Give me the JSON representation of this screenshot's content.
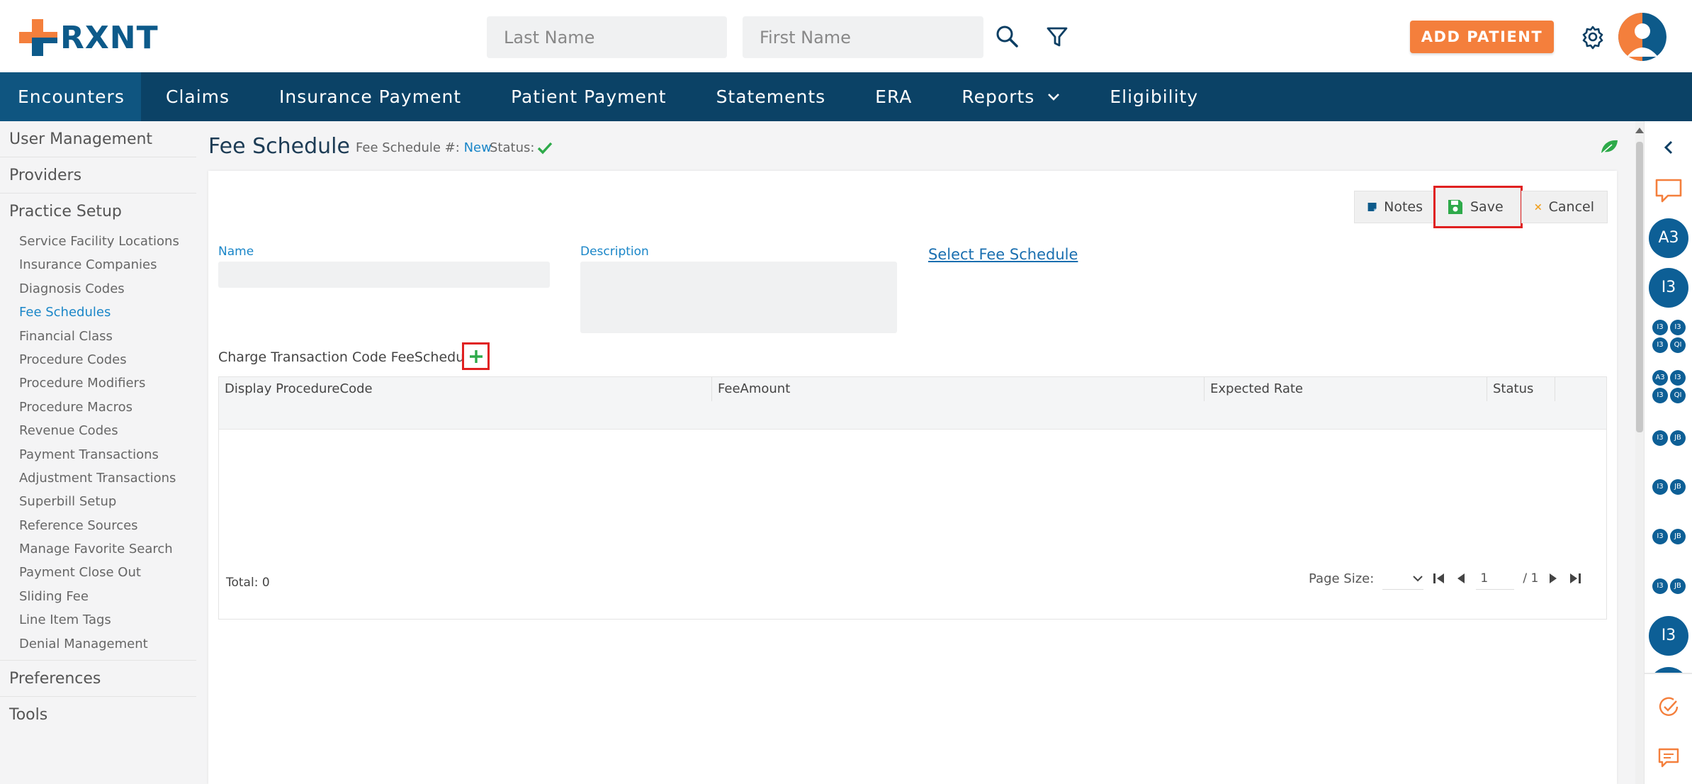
{
  "header": {
    "logo_text": "RXNT",
    "last_name_placeholder": "Last Name",
    "first_name_placeholder": "First Name",
    "add_patient_label": "ADD PATIENT",
    "icons": [
      "search-icon",
      "filter-icon",
      "gear-icon",
      "user-avatar-icon"
    ]
  },
  "nav": {
    "items": [
      "Encounters",
      "Claims",
      "Insurance Payment",
      "Patient Payment",
      "Statements",
      "ERA",
      "Reports",
      "Eligibility"
    ],
    "active": "Encounters"
  },
  "sidebar": {
    "sections": [
      "User Management",
      "Providers",
      "Practice Setup",
      "Preferences",
      "Tools"
    ],
    "practice_setup_items": [
      "Service Facility Locations",
      "Insurance Companies",
      "Diagnosis Codes",
      "Fee Schedules",
      "Financial Class",
      "Procedure Codes",
      "Procedure Modifiers",
      "Procedure Macros",
      "Revenue Codes",
      "Payment Transactions",
      "Adjustment Transactions",
      "Superbill Setup",
      "Reference Sources",
      "Manage Favorite Search",
      "Payment Close Out",
      "Sliding Fee",
      "Line Item Tags",
      "Denial Management"
    ],
    "active_item": "Fee Schedules"
  },
  "page": {
    "title": "Fee Schedule",
    "fee_schedule_label": "Fee Schedule #:",
    "fee_schedule_value": "New",
    "status_label": "Status:"
  },
  "toolbar": {
    "notes_label": "Notes",
    "save_label": "Save",
    "cancel_label": "Cancel"
  },
  "form": {
    "name_label": "Name",
    "name_value": "",
    "description_label": "Description",
    "description_value": "",
    "select_fee_schedule_link": "Select Fee Schedule",
    "charge_transaction_label": "Charge Transaction Code FeeSchedule:"
  },
  "grid": {
    "columns": [
      "Display ProcedureCode",
      "FeeAmount",
      "Expected Rate",
      "Status"
    ],
    "rows": [],
    "total_label": "Total: 0",
    "page_size_label": "Page Size:",
    "page_number": "1",
    "page_total": "/ 1"
  },
  "right_panel": {
    "badges_large": [
      "A3",
      "I3",
      "I3"
    ],
    "badge_groups": [
      [
        "I3",
        "I3",
        "I3",
        "QI"
      ],
      [
        "A3",
        "I3",
        "I3",
        "QI"
      ],
      [
        "I3",
        "JB"
      ],
      [
        "I3",
        "JB"
      ],
      [
        "I3",
        "JB"
      ],
      [
        "I3",
        "JB"
      ]
    ]
  },
  "colors": {
    "brand_blue": "#0d5a8a",
    "nav_bg": "#0b4266",
    "accent_orange": "#f47f3c",
    "link_blue": "#1a86c8",
    "success_green": "#2eaa4a",
    "highlight_red": "#e02020"
  }
}
